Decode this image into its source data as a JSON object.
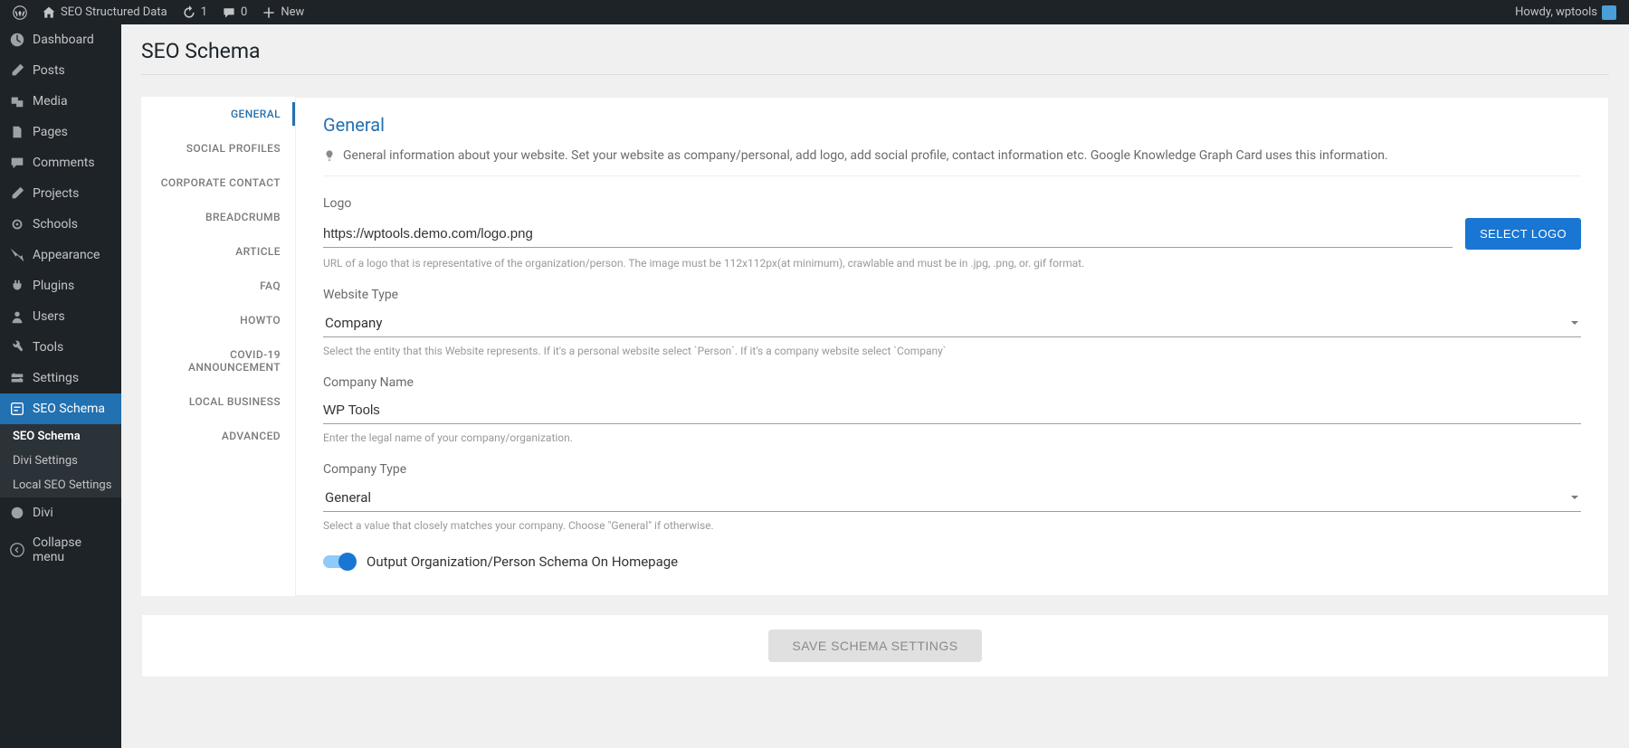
{
  "toolbar": {
    "site_name": "SEO Structured Data",
    "refresh_count": "1",
    "comments_count": "0",
    "new_label": "New",
    "greeting": "Howdy, wptools"
  },
  "sidebar": {
    "items": [
      {
        "label": "Dashboard"
      },
      {
        "label": "Posts"
      },
      {
        "label": "Media"
      },
      {
        "label": "Pages"
      },
      {
        "label": "Comments"
      },
      {
        "label": "Projects"
      },
      {
        "label": "Schools"
      },
      {
        "label": "Appearance"
      },
      {
        "label": "Plugins"
      },
      {
        "label": "Users"
      },
      {
        "label": "Tools"
      },
      {
        "label": "Settings"
      },
      {
        "label": "SEO Schema"
      },
      {
        "label": "Divi"
      },
      {
        "label": "Collapse menu"
      }
    ],
    "submenu": [
      {
        "label": "SEO Schema"
      },
      {
        "label": "Divi Settings"
      },
      {
        "label": "Local SEO Settings"
      }
    ]
  },
  "page": {
    "title": "SEO Schema"
  },
  "tabs": [
    {
      "label": "GENERAL"
    },
    {
      "label": "SOCIAL PROFILES"
    },
    {
      "label": "CORPORATE CONTACT"
    },
    {
      "label": "BREADCRUMB"
    },
    {
      "label": "ARTICLE"
    },
    {
      "label": "FAQ"
    },
    {
      "label": "HOWTO"
    },
    {
      "label": "COVID-19 ANNOUNCEMENT"
    },
    {
      "label": "LOCAL BUSINESS"
    },
    {
      "label": "ADVANCED"
    }
  ],
  "panel": {
    "title": "General",
    "description": "General information about your website. Set your website as company/personal, add logo, add social profile, contact information etc. Google Knowledge Graph Card uses this information.",
    "logo": {
      "label": "Logo",
      "value": "https://wptools.demo.com/logo.png",
      "button": "SELECT LOGO",
      "help": "URL of a logo that is representative of the organization/person. The image must be 112x112px(at minimum), crawlable and must be in .jpg, .png, or. gif format."
    },
    "website_type": {
      "label": "Website Type",
      "value": "Company",
      "help": "Select the entity that this Website represents. If it's a personal website select `Person`. If it's a company website select `Company`"
    },
    "company_name": {
      "label": "Company Name",
      "value": "WP Tools",
      "help": "Enter the legal name of your company/organization."
    },
    "company_type": {
      "label": "Company Type",
      "value": "General",
      "help": "Select a value that closely matches your company. Choose \"General\" if otherwise."
    },
    "toggle_label": "Output Organization/Person Schema On Homepage",
    "save_label": "SAVE SCHEMA SETTINGS"
  }
}
